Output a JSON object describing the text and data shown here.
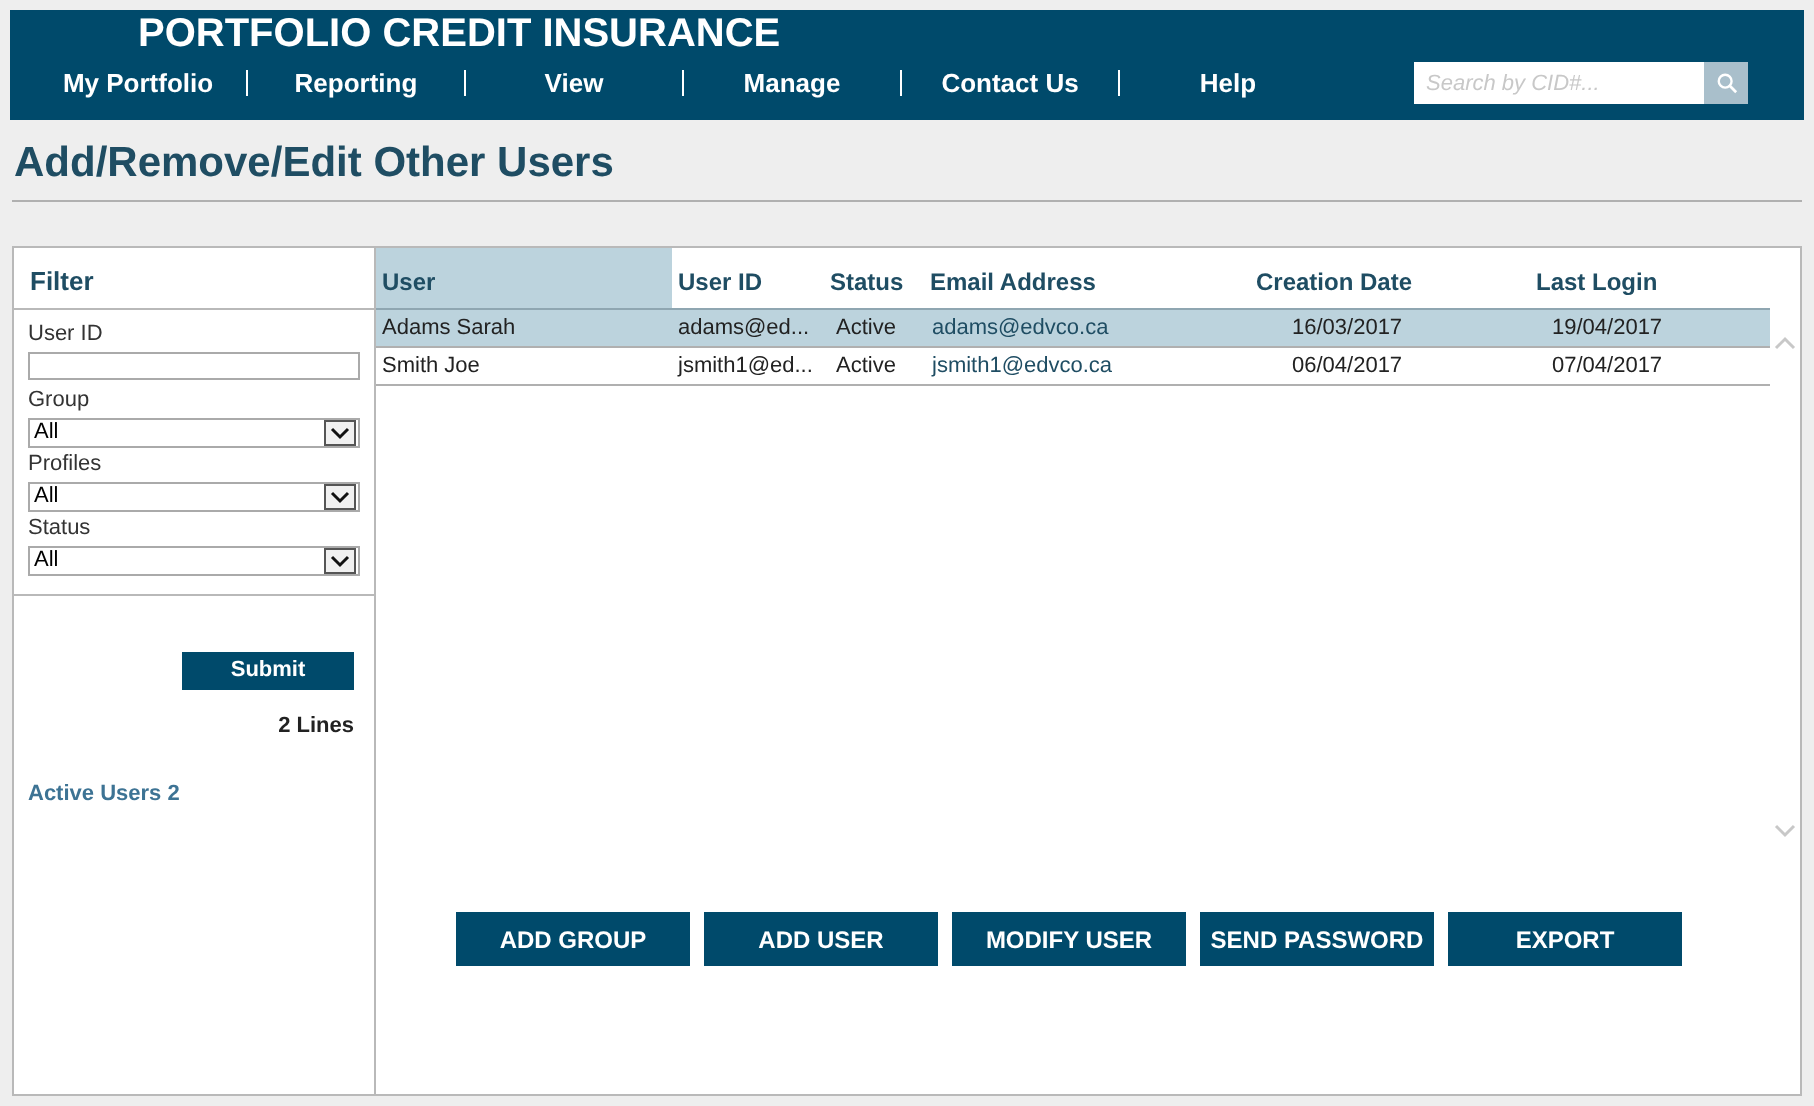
{
  "header": {
    "title": "PORTFOLIO CREDIT INSURANCE",
    "nav": [
      "My Portfolio",
      "Reporting",
      "View",
      "Manage",
      "Contact Us",
      "Help"
    ],
    "search": {
      "placeholder": "Search by CID#..."
    }
  },
  "page_title": "Add/Remove/Edit Other Users",
  "filter": {
    "title": "Filter",
    "fields": [
      {
        "kind": "text",
        "label": "User ID"
      },
      {
        "kind": "select",
        "label": "Group",
        "value": "All"
      },
      {
        "kind": "select",
        "label": "Profiles",
        "value": "All"
      },
      {
        "kind": "select",
        "label": "Status",
        "value": "All"
      }
    ],
    "submit": "Submit",
    "line_count": "2 Lines",
    "active_users": "Active Users 2"
  },
  "table": {
    "columns": [
      {
        "label": "User",
        "selected": true
      },
      {
        "label": "User ID",
        "selected": false
      },
      {
        "label": "Status",
        "selected": false
      },
      {
        "label": "Email Address",
        "selected": false
      },
      {
        "label": "Creation Date",
        "selected": false
      },
      {
        "label": "Last Login",
        "selected": false
      }
    ],
    "rows": [
      {
        "selected": true,
        "cells": [
          "Adams Sarah",
          "adams@ed...",
          "Active",
          "adams@edvco.ca",
          "16/03/2017",
          "19/04/2017"
        ]
      },
      {
        "selected": false,
        "cells": [
          "Smith Joe",
          "jsmith1@ed...",
          "Active",
          "jsmith1@edvco.ca",
          "06/04/2017",
          "07/04/2017"
        ]
      }
    ]
  },
  "actions": [
    "ADD GROUP",
    "ADD USER",
    "MODIFY USER",
    "SEND PASSWORD",
    "EXPORT"
  ]
}
